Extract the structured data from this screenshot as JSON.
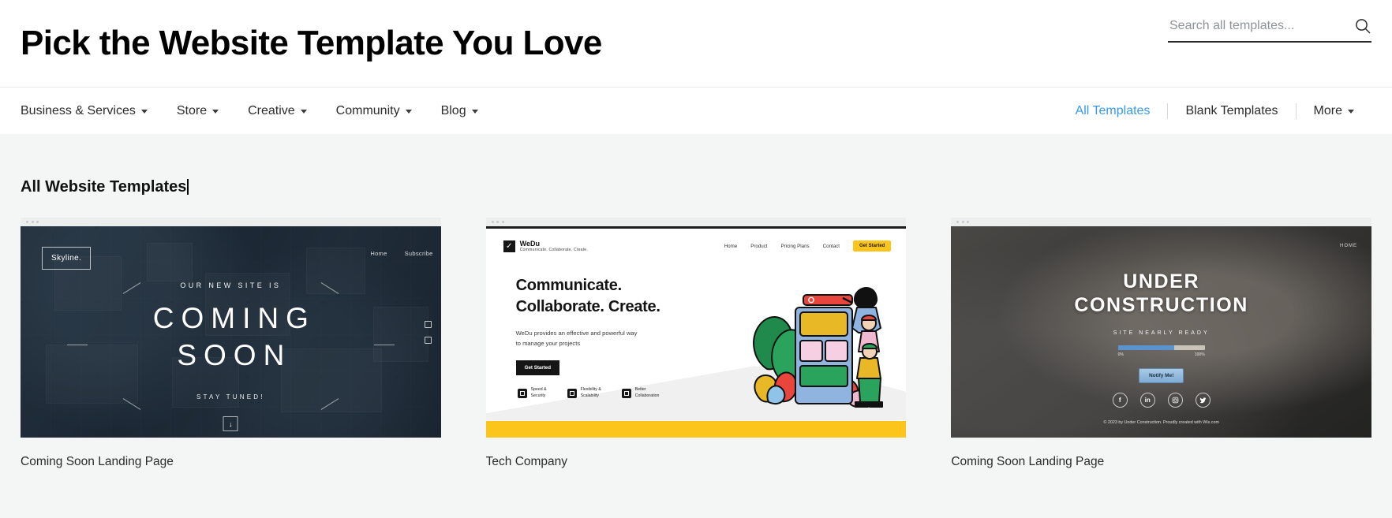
{
  "header": {
    "title": "Pick the Website Template You Love",
    "search": {
      "placeholder": "Search all templates...",
      "value": "",
      "icon": "search-icon"
    }
  },
  "nav": {
    "categories": [
      {
        "label": "Business & Services",
        "icon": "chevron-down-icon"
      },
      {
        "label": "Store",
        "icon": "chevron-down-icon"
      },
      {
        "label": "Creative",
        "icon": "chevron-down-icon"
      },
      {
        "label": "Community",
        "icon": "chevron-down-icon"
      },
      {
        "label": "Blog",
        "icon": "chevron-down-icon"
      }
    ],
    "right_links": [
      {
        "label": "All Templates",
        "active": true
      },
      {
        "label": "Blank Templates",
        "active": false
      },
      {
        "label": "More",
        "active": false,
        "icon": "chevron-down-icon"
      }
    ],
    "active_color": "#3899ec"
  },
  "main": {
    "section_title": "All Website Templates",
    "cards": [
      {
        "title": "Coming Soon Landing Page",
        "preview": {
          "logo": "Skyline.",
          "nav": [
            "Home",
            "Subscribe"
          ],
          "kicker": "OUR NEW SITE IS",
          "headline_line1": "COMING",
          "headline_line2": "SOON",
          "footer_text": "STAY TUNED!",
          "scroll_icon": "down-arrow-icon"
        }
      },
      {
        "title": "Tech Company",
        "preview": {
          "brand": "WeDu",
          "tagline": "Communicate. Collaborate. Create.",
          "nav": [
            "Home",
            "Product",
            "Pricing Plans",
            "Contact"
          ],
          "nav_cta": "Get Started",
          "headline_line1": "Communicate.",
          "headline_line2": "Collaborate. Create.",
          "subtext": "WeDu provides an effective and powerful way to manage your projects",
          "cta": "Get Started",
          "features": [
            {
              "line1": "Speed &",
              "line2": "Security",
              "icon": "lock-icon"
            },
            {
              "line1": "Flexibility &",
              "line2": "Scalability",
              "icon": "expand-icon"
            },
            {
              "line1": "Better",
              "line2": "Collaboration",
              "icon": "people-icon"
            }
          ],
          "accent_color": "#fcc51b"
        }
      },
      {
        "title": "Coming Soon Landing Page",
        "preview": {
          "nav": [
            "HOME"
          ],
          "headline_line1": "UNDER",
          "headline_line2": "CONSTRUCTION",
          "subtext": "SITE NEARLY READY",
          "progress": {
            "min_label": "0%",
            "max_label": "100%",
            "percent": 65
          },
          "cta": "Notify Me!",
          "socials": [
            "facebook-icon",
            "linkedin-icon",
            "instagram-icon",
            "twitter-icon"
          ],
          "footer": "© 2023 by Under Construction. Proudly created with Wix.com"
        }
      }
    ]
  }
}
